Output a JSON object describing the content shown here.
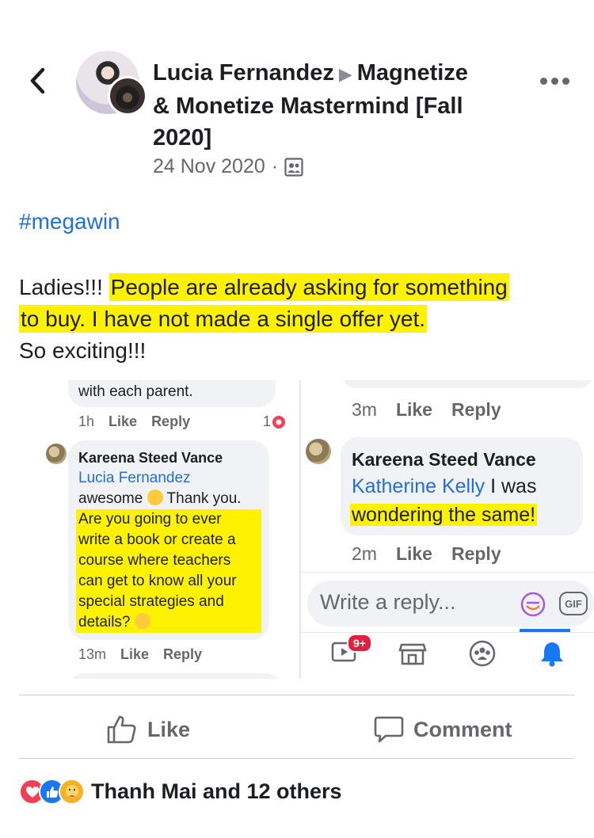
{
  "post": {
    "author": "Lucia Fernandez",
    "group_line1": "Magnetize",
    "group_line2": "& Monetize Mastermind [Fall",
    "group_line3": "2020]",
    "date": "24 Nov 2020",
    "hashtag": "#megawin",
    "text_lead": "Ladies!!! ",
    "text_highlight_1": "People are already asking for something",
    "text_highlight_2": "to buy. I have not made a single offer yet.",
    "text_tail": "So exciting!!!"
  },
  "image": {
    "left": {
      "prev_comment_tail": "with each parent.",
      "prev_meta_time": "1h",
      "prev_meta_like": "Like",
      "prev_meta_reply": "Reply",
      "prev_reaction_count": "1",
      "comment_author": "Kareena Steed Vance",
      "mention": "Lucia Fernandez",
      "line_awesome": "awesome",
      "line_thanks": "Thank you.",
      "hl_1": "Are you going to ever",
      "hl_2": "write a book or create a",
      "hl_3": "course where teachers",
      "hl_4": "can get to know all your",
      "hl_5": "special strategies and",
      "hl_6": "details?",
      "meta_time": "13m",
      "meta_like": "Like",
      "meta_reply": "Reply"
    },
    "right": {
      "prev_meta_time": "3m",
      "prev_meta_like": "Like",
      "prev_meta_reply": "Reply",
      "comment_author": "Kareena Steed Vance",
      "mention": "Katherine Kelly",
      "line_1_rest": " I was",
      "hl_line": "wondering the same!",
      "meta_time": "2m",
      "meta_like": "Like",
      "meta_reply": "Reply",
      "reply_placeholder": "Write a reply...",
      "gif_label": "GIF",
      "nav_badge": "9+"
    }
  },
  "actions": {
    "like": "Like",
    "comment": "Comment"
  },
  "reactions": {
    "summary": "Thanh Mai and 12 others"
  }
}
